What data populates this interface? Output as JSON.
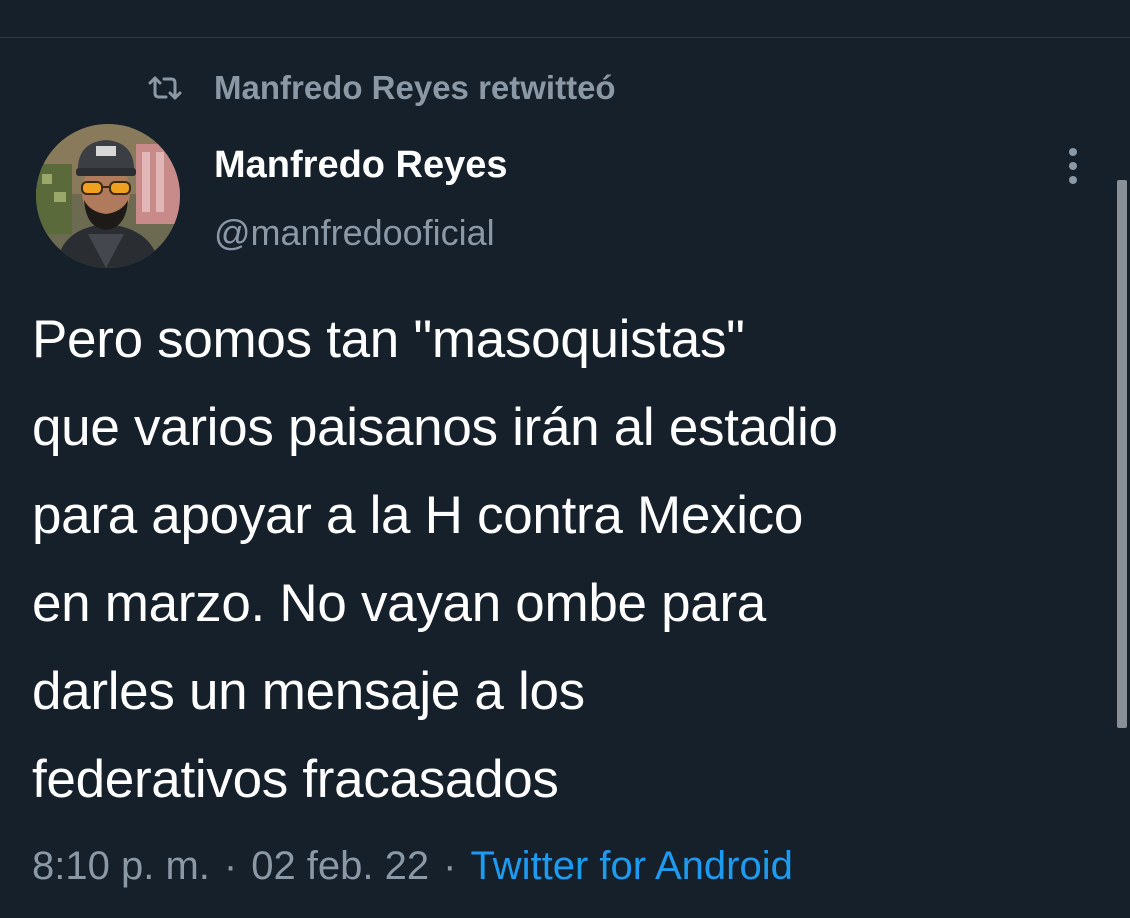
{
  "retweet": {
    "icon": "retweet-icon",
    "text": "Manfredo Reyes retwitteó"
  },
  "author": {
    "display_name": "Manfredo Reyes",
    "handle": "@manfredooficial",
    "avatar": "avatar"
  },
  "tweet": {
    "lines": [
      "Pero somos tan \"masoquistas\"",
      "que varios paisanos irán al estadio",
      "para apoyar a la H contra Mexico",
      "en marzo. No vayan ombe para",
      "darles un mensaje a los",
      "federativos fracasados"
    ]
  },
  "meta": {
    "time": "8:10 p. m.",
    "separator": "·",
    "date": "02 feb. 22",
    "source": "Twitter for Android"
  },
  "colors": {
    "background": "#15202b",
    "primary_text": "#ffffff",
    "secondary_text": "#8b98a5",
    "link": "#1d9bf0"
  }
}
